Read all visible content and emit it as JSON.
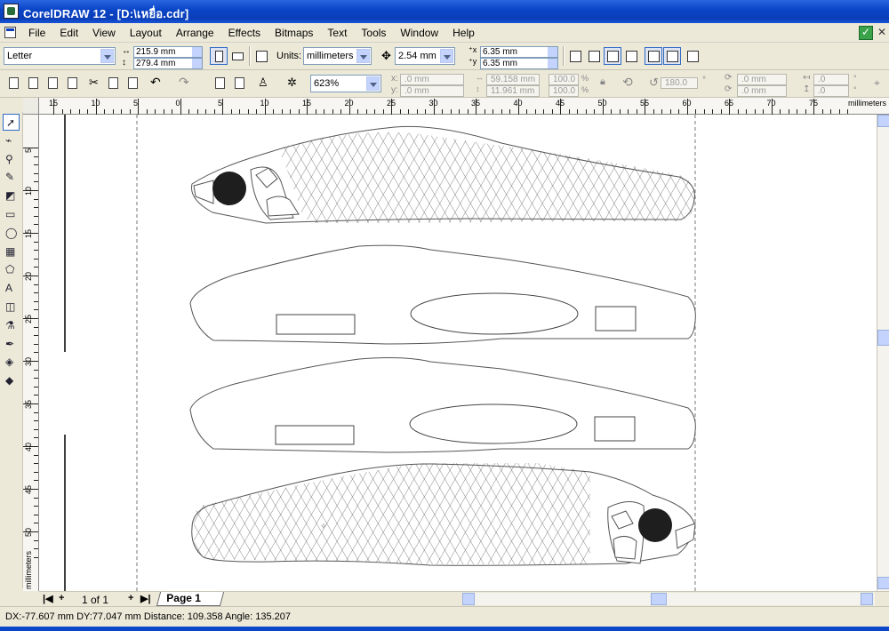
{
  "window": {
    "title": "CorelDRAW 12 - [D:\\เหยื่อ.cdr]"
  },
  "menu": [
    "File",
    "Edit",
    "View",
    "Layout",
    "Arrange",
    "Effects",
    "Bitmaps",
    "Text",
    "Tools",
    "Window",
    "Help"
  ],
  "property_bar": {
    "paper_size": "Letter",
    "page_width": "215.9 mm",
    "page_height": "279.4 mm",
    "units_label": "Units:",
    "units": "millimeters",
    "nudge": "2.54 mm",
    "dup_x": "6.35 mm",
    "dup_y": "6.35 mm"
  },
  "standard_bar": {
    "zoom": "623%",
    "pos_x_label": "x:",
    "pos_x": ".0 mm",
    "pos_y_label": "y:",
    "pos_y": ".0 mm",
    "size_w": "59.158 mm",
    "size_h": "11.961 mm",
    "scale_x": "100.0",
    "scale_y": "100.0",
    "percent": "%",
    "rotation": "180.0",
    "degree": "°",
    "skew_x": ".0 mm",
    "skew_y": ".0 mm",
    "mirror_a": ".0",
    "mirror_b": ".0"
  },
  "ruler": {
    "h_labels": [
      "15",
      "10",
      "5",
      "0",
      "5",
      "10",
      "15",
      "20",
      "25",
      "30",
      "35",
      "40",
      "45",
      "50",
      "55",
      "60",
      "65",
      "70",
      "75"
    ],
    "h_units": "millimeters",
    "v_labels": [
      "5",
      "10",
      "15",
      "20",
      "25",
      "30",
      "35",
      "40",
      "45",
      "50"
    ],
    "v_units": "millimeters"
  },
  "toolbox": [
    "pick-tool",
    "shape-tool",
    "zoom-tool",
    "freehand-tool",
    "smart-fill-tool",
    "rectangle-tool",
    "ellipse-tool",
    "graph-paper-tool",
    "basic-shapes-tool",
    "text-tool",
    "interactive-blend-tool",
    "eyedropper-tool",
    "outline-tool",
    "fill-tool",
    "interactive-fill-tool"
  ],
  "pages": {
    "count": "1 of 1",
    "tab": "Page 1"
  },
  "status": {
    "text": "DX:-77.607 mm DY:77.047 mm Distance: 109.358 Angle: 135.207"
  },
  "colors": {
    "title_blue": "#0a46c8",
    "accent": "#316ac5",
    "eye": "#1e1e1e"
  }
}
